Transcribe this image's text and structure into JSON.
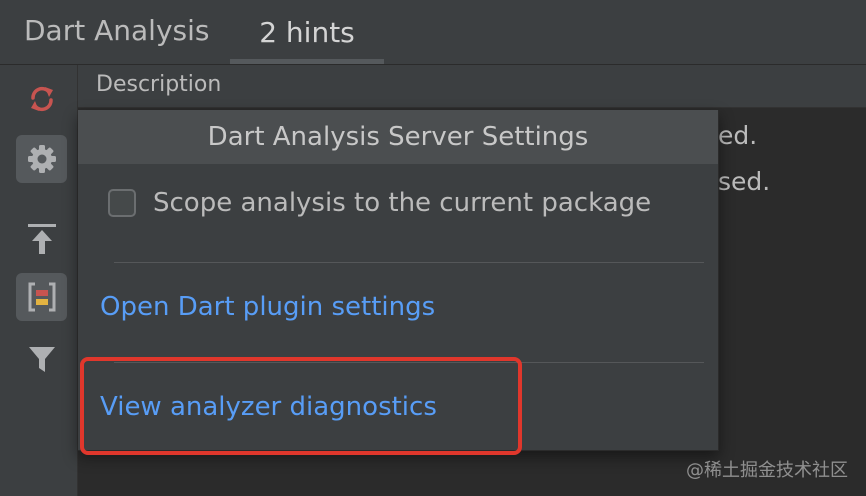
{
  "panel": {
    "title": "Dart Analysis",
    "tab": "2 hints"
  },
  "toolbar": {
    "items": [
      {
        "icon": "refresh-icon",
        "color": "#c75450"
      },
      {
        "icon": "gear-icon"
      },
      {
        "icon": "scroll-to-source-icon"
      },
      {
        "icon": "group-by-file-icon",
        "color": "#c75450"
      },
      {
        "icon": "filter-icon"
      }
    ]
  },
  "table": {
    "column_header": "Description",
    "rows": [
      "ed.",
      "sed."
    ]
  },
  "popup": {
    "title": "Dart Analysis Server Settings",
    "checkbox_label": "Scope analysis to the current package",
    "checkbox_checked": false,
    "link_plugin_settings": "Open Dart plugin settings",
    "link_diagnostics": "View analyzer diagnostics"
  },
  "highlight_color": "#e0372c",
  "watermark": "@稀土掘金技术社区"
}
